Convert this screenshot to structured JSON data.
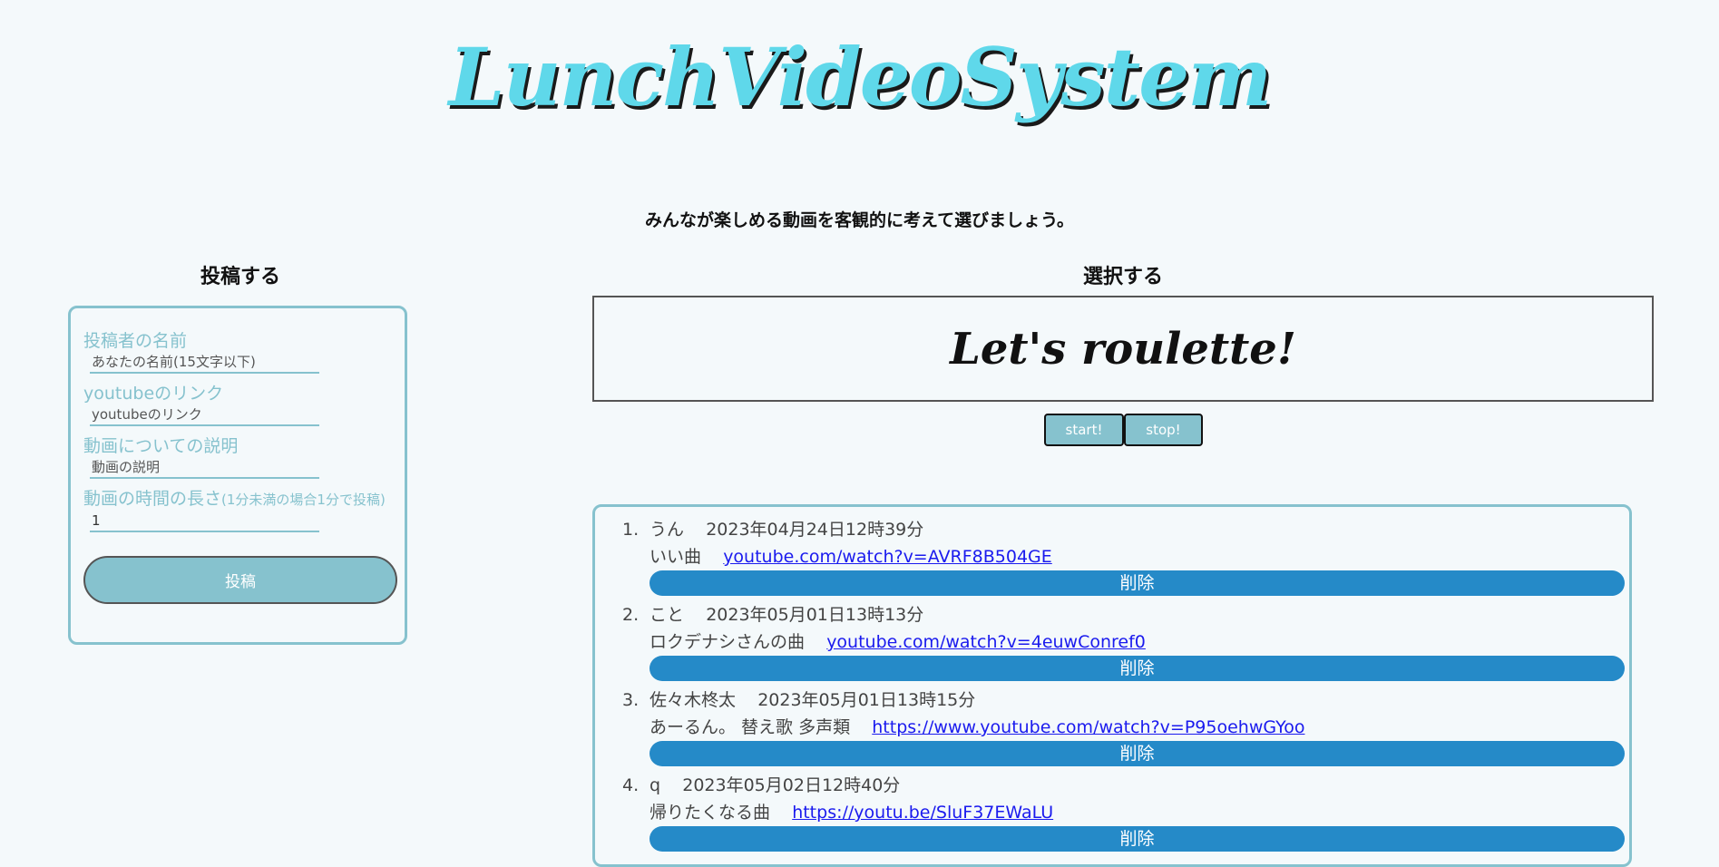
{
  "site": {
    "title": "LunchVideoSystem",
    "tagline": "みんなが楽しめる動画を客観的に考えて選びましょう。"
  },
  "post_section": {
    "heading": "投稿する",
    "fields": [
      {
        "label": "投稿者の名前",
        "note": "",
        "placeholder": "あなたの名前(15文字以下)",
        "value": ""
      },
      {
        "label": "youtubeのリンク",
        "note": "",
        "placeholder": "youtubeのリンク",
        "value": ""
      },
      {
        "label": "動画についての説明",
        "note": "",
        "placeholder": "動画の説明",
        "value": ""
      },
      {
        "label": "動画の時間の長さ",
        "note": "(1分未満の場合1分で投稿)",
        "placeholder": "",
        "value": "1"
      }
    ],
    "submit_label": "投稿"
  },
  "select_section": {
    "heading": "選択する",
    "roulette_text": "Let's roulette!",
    "start_label": "start!",
    "stop_label": "stop!"
  },
  "videos": [
    {
      "num": "1.",
      "poster": "うん",
      "datetime": "2023年04月24日12時39分",
      "description": "いい曲",
      "link": "youtube.com/watch?v=AVRF8B504GE",
      "delete_label": "削除"
    },
    {
      "num": "2.",
      "poster": "こと",
      "datetime": "2023年05月01日13時13分",
      "description": "ロクデナシさんの曲",
      "link": "youtube.com/watch?v=4euwConref0",
      "delete_label": "削除"
    },
    {
      "num": "3.",
      "poster": "佐々木柊太",
      "datetime": "2023年05月01日13時15分",
      "description": "あーるん。 替え歌 多声類",
      "link": "https://www.youtube.com/watch?v=P95oehwGYoo",
      "delete_label": "削除"
    },
    {
      "num": "4.",
      "poster": "q",
      "datetime": "2023年05月02日12時40分",
      "description": "帰りたくなる曲",
      "link": "https://youtu.be/SluF37EWaLU",
      "delete_label": "削除"
    }
  ],
  "colors": {
    "background": "#f4f9fb",
    "title_fill": "#5fd8ea",
    "accent": "#86c2ce",
    "delete_button": "#258ac8",
    "link": "#1a1aee"
  }
}
